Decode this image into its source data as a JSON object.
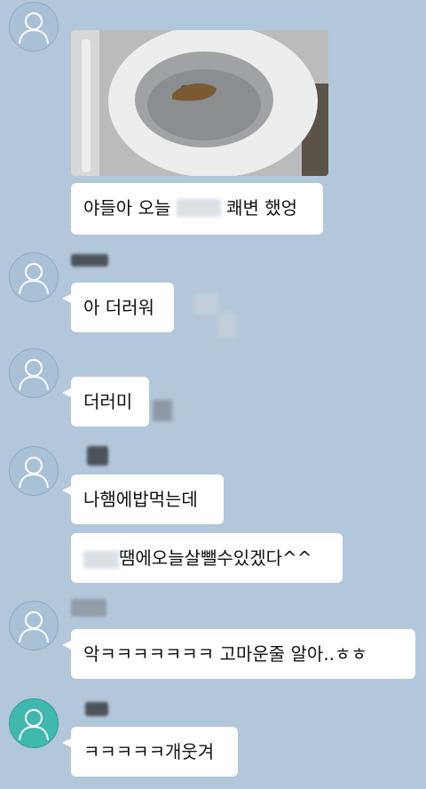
{
  "chat": {
    "messages": [
      {
        "text": "야들아 오늘 ",
        "text_after": " 쾌변 했엉"
      },
      {
        "text": "아 더러워"
      },
      {
        "text": "더러미"
      },
      {
        "text": "나햄에밥먹는데"
      },
      {
        "text": "땜에오늘살뺄수있겠다^^"
      },
      {
        "text": "악ㅋㅋㅋㅋㅋㅋㅋ 고마운줄 알아..ㅎㅎ"
      },
      {
        "text": "ㅋㅋㅋㅋㅋ개웃겨"
      }
    ]
  },
  "colors": {
    "background": "#b2c7d9",
    "bubble": "#ffffff",
    "avatar_default": "#a9c1d6",
    "avatar_self": "#3fb8ad"
  },
  "icons": {
    "avatar": "person-silhouette-icon"
  }
}
